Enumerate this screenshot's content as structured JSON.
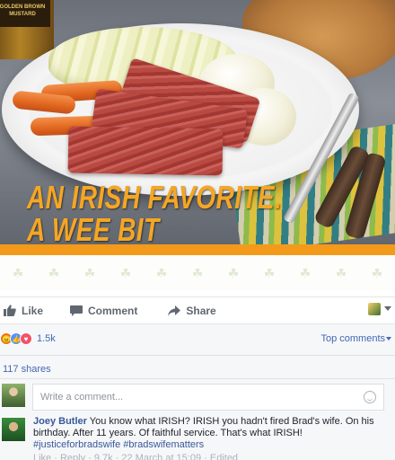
{
  "photo": {
    "jar_label": "GOLDEN BROWN MUSTARD",
    "headline_line1": "AN IRISH FAVORITE.",
    "headline_line2": "A WEE BIT SOUTHERN."
  },
  "actions": {
    "like_label": "Like",
    "comment_label": "Comment",
    "share_label": "Share"
  },
  "reactions": {
    "count": "1.5k",
    "top_comments_label": "Top comments"
  },
  "shares": {
    "label": "117 shares"
  },
  "composer": {
    "placeholder": "Write a comment..."
  },
  "comment": {
    "author": "Joey Butler",
    "text": " You know what IRISH? IRISH you hadn't fired Brad's wife. On his birthday. After 11 years. Of faithful service. That's what IRISH! ",
    "tag1": "#justiceforbradswife",
    "tag2": "#bradswifematters",
    "meta": "Like · Reply · 9.7k · 22 March at 15:09 · Edited"
  },
  "colors": {
    "headline": "#f5a623",
    "orange_bar": "#f49a1a",
    "link_blue": "#4267b2",
    "author_blue": "#365899"
  }
}
